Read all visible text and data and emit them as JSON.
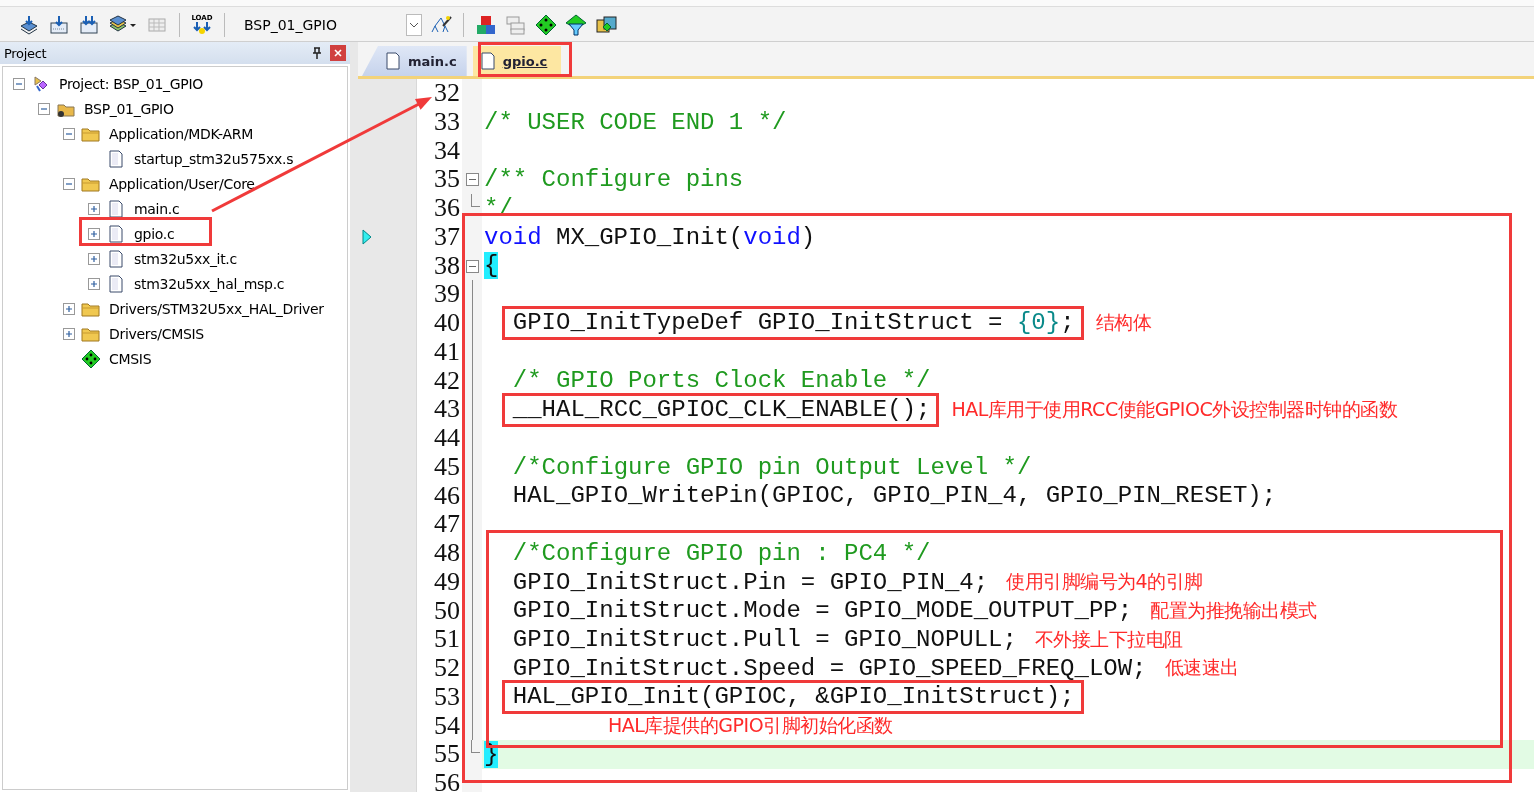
{
  "toolbar": {
    "load_label": "LOAD",
    "target": "BSP_01_GPIO"
  },
  "project_panel": {
    "title": "Project",
    "tree": [
      {
        "label": "Project: BSP_01_GPIO",
        "kind": "project",
        "expanded": true,
        "selected": false,
        "children": [
          {
            "label": "BSP_01_GPIO",
            "kind": "target",
            "expanded": true,
            "selected": false,
            "children": [
              {
                "label": "Application/MDK-ARM",
                "kind": "folder",
                "expanded": true,
                "selected": false,
                "children": [
                  {
                    "label": "startup_stm32u575xx.s",
                    "kind": "file",
                    "selected": false
                  }
                ]
              },
              {
                "label": "Application/User/Core",
                "kind": "folder",
                "expanded": true,
                "selected": false,
                "children": [
                  {
                    "label": "main.c",
                    "kind": "file",
                    "expanded": false,
                    "selected": false
                  },
                  {
                    "label": "gpio.c",
                    "kind": "file",
                    "expanded": false,
                    "selected": false
                  },
                  {
                    "label": "stm32u5xx_it.c",
                    "kind": "file",
                    "expanded": false,
                    "selected": false
                  },
                  {
                    "label": "stm32u5xx_hal_msp.c",
                    "kind": "file",
                    "expanded": false,
                    "selected": false
                  }
                ]
              },
              {
                "label": "Drivers/STM32U5xx_HAL_Driver",
                "kind": "folder",
                "expanded": false,
                "selected": false
              },
              {
                "label": "Drivers/CMSIS",
                "kind": "folder",
                "expanded": false,
                "selected": false
              },
              {
                "label": "CMSIS",
                "kind": "component",
                "selected": false
              }
            ]
          }
        ]
      }
    ]
  },
  "tabs": [
    {
      "label": "main.c",
      "selected": false
    },
    {
      "label": "gpio.c",
      "selected": true
    }
  ],
  "editor": {
    "lines": [
      {
        "number": "32",
        "kind": "normal",
        "boxed": false,
        "current": false,
        "pointer": false
      },
      {
        "number": "33",
        "segments": [
          {
            "kind": "comment",
            "text": "/* USER CODE END 1 */"
          }
        ],
        "kind": "normal",
        "boxed": false,
        "current": false,
        "pointer": false
      },
      {
        "number": "34",
        "kind": "normal",
        "boxed": false,
        "current": false,
        "pointer": false
      },
      {
        "number": "35",
        "segments": [
          {
            "kind": "comment",
            "text": "/** Configure pins"
          }
        ],
        "kind": "open",
        "boxed": false,
        "current": false,
        "pointer": false
      },
      {
        "number": "36",
        "segments": [
          {
            "kind": "comment",
            "text": "*/"
          }
        ],
        "kind": "close",
        "boxed": false,
        "current": false,
        "pointer": false
      },
      {
        "number": "37",
        "segments": [
          {
            "kind": "keyword",
            "text": "void"
          },
          {
            "kind": "plain",
            "text": " MX_GPIO_Init("
          },
          {
            "kind": "keyword",
            "text": "void"
          },
          {
            "kind": "plain",
            "text": ")"
          }
        ],
        "kind": "normal",
        "boxed": false,
        "current": false,
        "pointer": true
      },
      {
        "number": "38",
        "segments": [
          {
            "kind": "match",
            "text": "{"
          }
        ],
        "kind": "open",
        "boxed": false,
        "current": false,
        "pointer": false
      },
      {
        "number": "39",
        "kind": "inner",
        "boxed": false,
        "current": false,
        "pointer": false
      },
      {
        "number": "40",
        "segments": [
          {
            "kind": "plain",
            "text": "  GPIO_InitTypeDef GPIO_InitStruct = "
          },
          {
            "kind": "number",
            "text": "{0}"
          },
          {
            "kind": "plain",
            "text": ";"
          }
        ],
        "note": "结构体",
        "kind": "inner",
        "boxed": true,
        "current": false,
        "pointer": false
      },
      {
        "number": "41",
        "kind": "inner",
        "boxed": false,
        "current": false,
        "pointer": false
      },
      {
        "number": "42",
        "segments": [
          {
            "kind": "comment",
            "text": "  /* GPIO Ports Clock Enable */"
          }
        ],
        "kind": "inner",
        "boxed": false,
        "current": false,
        "pointer": false
      },
      {
        "number": "43",
        "segments": [
          {
            "kind": "plain",
            "text": "  __HAL_RCC_GPIOC_CLK_ENABLE();"
          }
        ],
        "note": "HAL库用于使用RCC使能GPIOC外设控制器时钟的函数",
        "kind": "inner",
        "boxed": true,
        "current": false,
        "pointer": false
      },
      {
        "number": "44",
        "kind": "inner",
        "boxed": false,
        "current": false,
        "pointer": false
      },
      {
        "number": "45",
        "segments": [
          {
            "kind": "comment",
            "text": "  /*Configure GPIO pin Output Level */"
          }
        ],
        "kind": "inner",
        "boxed": false,
        "current": false,
        "pointer": false
      },
      {
        "number": "46",
        "segments": [
          {
            "kind": "plain",
            "text": "  HAL_GPIO_WritePin(GPIOC, GPIO_PIN_4, GPIO_PIN_RESET);"
          }
        ],
        "kind": "inner",
        "boxed": false,
        "current": false,
        "pointer": false
      },
      {
        "number": "47",
        "kind": "inner",
        "boxed": false,
        "current": false,
        "pointer": false
      },
      {
        "number": "48",
        "segments": [
          {
            "kind": "comment",
            "text": "  /*Configure GPIO pin : PC4 */"
          }
        ],
        "kind": "inner",
        "boxed": false,
        "current": false,
        "pointer": false
      },
      {
        "number": "49",
        "segments": [
          {
            "kind": "plain",
            "text": "  GPIO_InitStruct.Pin = GPIO_PIN_4;"
          }
        ],
        "note": "使用引脚编号为4的引脚",
        "kind": "inner",
        "boxed": false,
        "current": false,
        "pointer": false
      },
      {
        "number": "50",
        "segments": [
          {
            "kind": "plain",
            "text": "  GPIO_InitStruct.Mode = GPIO_MODE_OUTPUT_PP;"
          }
        ],
        "note": "配置为推挽输出模式",
        "kind": "inner",
        "boxed": false,
        "current": false,
        "pointer": false
      },
      {
        "number": "51",
        "segments": [
          {
            "kind": "plain",
            "text": "  GPIO_InitStruct.Pull = GPIO_NOPULL;"
          }
        ],
        "note": "不外接上下拉电阻",
        "kind": "inner",
        "boxed": false,
        "current": false,
        "pointer": false
      },
      {
        "number": "52",
        "segments": [
          {
            "kind": "plain",
            "text": "  GPIO_InitStruct.Speed = GPIO_SPEED_FREQ_LOW;"
          }
        ],
        "note": "低速速出",
        "kind": "inner",
        "boxed": false,
        "current": false,
        "pointer": false
      },
      {
        "number": "53",
        "segments": [
          {
            "kind": "plain",
            "text": "  HAL_GPIO_Init(GPIOC, &GPIO_InitStruct);"
          }
        ],
        "kind": "inner",
        "boxed": true,
        "current": false,
        "pointer": false
      },
      {
        "number": "54",
        "note": "HAL库提供的GPIO引脚初始化函数",
        "kind": "inner",
        "boxed": false,
        "current": false,
        "pointer": false
      },
      {
        "number": "55",
        "segments": [
          {
            "kind": "match",
            "text": "}"
          }
        ],
        "kind": "close",
        "boxed": false,
        "current": true,
        "pointer": false
      },
      {
        "number": "56",
        "kind": "normal",
        "boxed": false,
        "current": false,
        "pointer": false
      }
    ]
  }
}
